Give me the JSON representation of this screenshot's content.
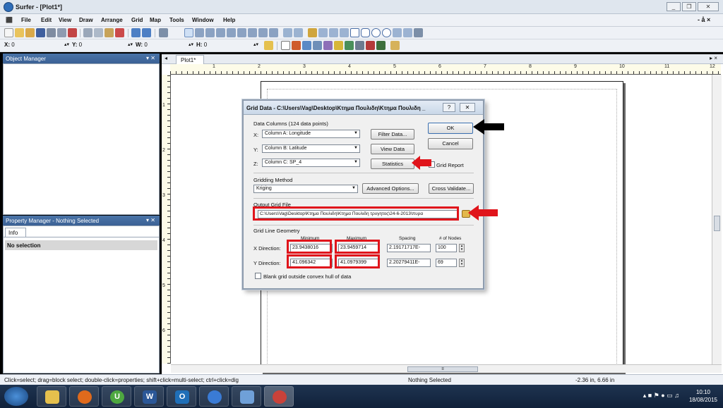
{
  "window": {
    "title": "Surfer - [Plot1*]",
    "controls": [
      "_",
      "❐",
      "✕"
    ]
  },
  "menu": {
    "items": [
      "File",
      "Edit",
      "View",
      "Draw",
      "Arrange",
      "Grid",
      "Map",
      "Tools",
      "Window",
      "Help"
    ],
    "mdi_controls": "- å ×"
  },
  "coords": {
    "x_label": "X:",
    "x_value": "0",
    "y_label": "Y:",
    "y_value": "0",
    "w_label": "W:",
    "w_value": "0",
    "h_label": "H:",
    "h_value": "0"
  },
  "object_manager": {
    "title": "Object Manager",
    "controls": "▾ ✕"
  },
  "property_manager": {
    "title": "Property Manager - Nothing Selected",
    "controls": "▾ ✕",
    "tab": "Info",
    "selection": "No selection"
  },
  "document": {
    "tab": "Plot1*",
    "close": "▸ ×"
  },
  "ruler": {
    "numbers": [
      "1",
      "2",
      "3",
      "4",
      "5",
      "6",
      "7",
      "8",
      "9",
      "10",
      "11",
      "12"
    ]
  },
  "dialog": {
    "title": "Grid Data - C:\\Users\\Vag\\Desktop\\Κτημα Πουλιδη\\Κτημα Πουλιδη _",
    "help_btn": "?",
    "close_btn": "✕",
    "data_columns_label": "Data Columns   (124 data points)",
    "x_label": "X:",
    "x_value": "Column A:  Longitude",
    "y_label": "Y:",
    "y_value": "Column B:  Latitude",
    "z_label": "Z:",
    "z_value": "Column C:  SP_4",
    "filter_data": "Filter Data...",
    "view_data": "View Data",
    "statistics": "Statistics",
    "ok": "OK",
    "cancel": "Cancel",
    "grid_report": "Grid Report",
    "gridding_method_label": "Gridding Method",
    "gridding_method": "Kriging",
    "advanced_options": "Advanced Options...",
    "cross_validate": "Cross Validate...",
    "output_grid_label": "Output Grid File",
    "output_grid_path": "C:\\Users\\Vag\\Desktop\\Κτημα Πουλιδη\\Κτημα Πουλιδη τρυγητος\\24-6-2013\\πυρα",
    "geometry_label": "Grid Line Geometry",
    "headers": {
      "min": "Minimum",
      "max": "Maximum",
      "spacing": "Spacing",
      "nodes": "# of Nodes"
    },
    "x_direction": {
      "label": "X Direction:",
      "min": "23.9438016",
      "max": "23.9459714",
      "spacing": "2.19171717E-",
      "nodes": "100"
    },
    "y_direction": {
      "label": "Y Direction:",
      "min": "41.096342",
      "max": "41.0979399",
      "spacing": "2.20279411E-",
      "nodes": "69"
    },
    "blank_grid": "Blank grid outside convex hull of data"
  },
  "status": {
    "hint": "Click=select; drag=block select; double-click=properties; shift+click=multi-select; ctrl+click=dig",
    "selection": "Nothing Selected",
    "position": "-2.36 in, 6.66 in"
  },
  "taskbar": {
    "time": "10:10",
    "date": "18/08/2015"
  },
  "colors": {
    "annotation_red": "#e0141b",
    "annotation_black": "#000000"
  }
}
